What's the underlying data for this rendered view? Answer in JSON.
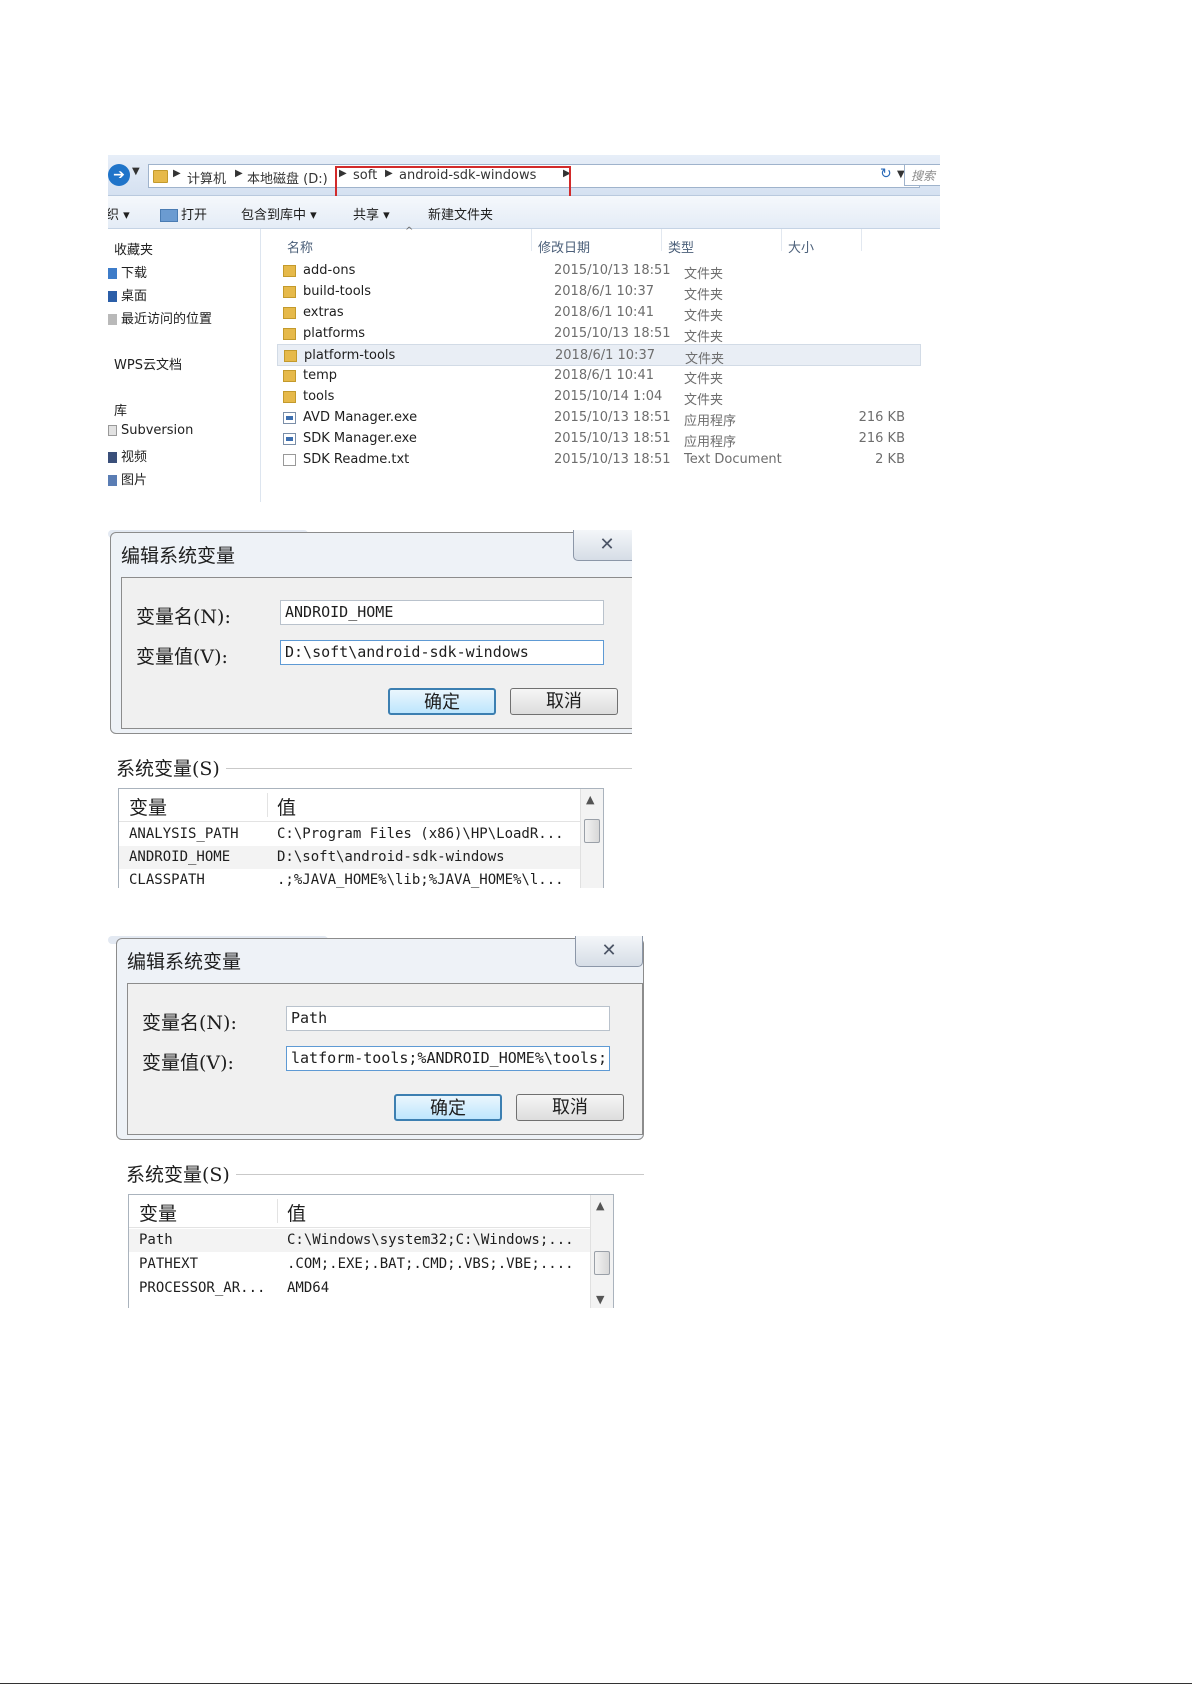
{
  "explorer": {
    "breadcrumbs": [
      "计算机",
      "本地磁盘 (D:)",
      "soft",
      "android-sdk-windows"
    ],
    "search_placeholder": "搜索",
    "toolbar": {
      "organize_label": "织",
      "open_label": "打开",
      "include_label": "包含到库中",
      "share_label": "共享",
      "new_folder_label": "新建文件夹"
    },
    "sidebar": {
      "favorites_label": "收藏夹",
      "items": [
        "下载",
        "桌面",
        "最近访问的位置"
      ],
      "wps_label": "WPS云文档",
      "library_label": "库",
      "library_items": [
        "Subversion",
        "视频",
        "图片"
      ]
    },
    "columns": {
      "name": "名称",
      "date": "修改日期",
      "type": "类型",
      "size": "大小"
    },
    "files": [
      {
        "name": "add-ons",
        "date": "2015/10/13 18:51",
        "type": "文件夹",
        "size": "",
        "icon": "folder-icon"
      },
      {
        "name": "build-tools",
        "date": "2018/6/1 10:37",
        "type": "文件夹",
        "size": "",
        "icon": "folder-icon"
      },
      {
        "name": "extras",
        "date": "2018/6/1 10:41",
        "type": "文件夹",
        "size": "",
        "icon": "folder-icon"
      },
      {
        "name": "platforms",
        "date": "2015/10/13 18:51",
        "type": "文件夹",
        "size": "",
        "icon": "folder-icon"
      },
      {
        "name": "platform-tools",
        "date": "2018/6/1 10:37",
        "type": "文件夹",
        "size": "",
        "icon": "folder-icon",
        "selected": true
      },
      {
        "name": "temp",
        "date": "2018/6/1 10:41",
        "type": "文件夹",
        "size": "",
        "icon": "folder-icon"
      },
      {
        "name": "tools",
        "date": "2015/10/14 1:04",
        "type": "文件夹",
        "size": "",
        "icon": "folder-icon"
      },
      {
        "name": "AVD Manager.exe",
        "date": "2015/10/13 18:51",
        "type": "应用程序",
        "size": "216 KB",
        "icon": "exe-icon"
      },
      {
        "name": "SDK Manager.exe",
        "date": "2015/10/13 18:51",
        "type": "应用程序",
        "size": "216 KB",
        "icon": "exe-icon"
      },
      {
        "name": "SDK Readme.txt",
        "date": "2015/10/13 18:51",
        "type": "Text Document",
        "size": "2 KB",
        "icon": "text-file-icon"
      }
    ]
  },
  "dialog1": {
    "title": "编辑系统变量",
    "close_glyph": "✕",
    "name_label": "变量名(N):",
    "name_value": "ANDROID_HOME",
    "value_label": "变量值(V):",
    "value_value": "D:\\soft\\android-sdk-windows",
    "ok_label": "确定",
    "cancel_label": "取消",
    "sysvars_label": "系统变量(S)",
    "table_headers": {
      "var": "变量",
      "val": "值"
    },
    "rows": [
      {
        "var": "ANALYSIS_PATH",
        "val": "C:\\Program Files (x86)\\HP\\LoadR..."
      },
      {
        "var": "ANDROID_HOME",
        "val": "D:\\soft\\android-sdk-windows"
      },
      {
        "var": "CLASSPATH",
        "val": ".;%JAVA_HOME%\\lib;%JAVA_HOME%\\l..."
      }
    ]
  },
  "dialog2": {
    "title": "编辑系统变量",
    "close_glyph": "✕",
    "name_label": "变量名(N):",
    "name_value": "Path",
    "value_label": "变量值(V):",
    "value_value": "latform-tools;%ANDROID_HOME%\\tools;",
    "ok_label": "确定",
    "cancel_label": "取消",
    "sysvars_label": "系统变量(S)",
    "table_headers": {
      "var": "变量",
      "val": "值"
    },
    "rows": [
      {
        "var": "Path",
        "val": "C:\\Windows\\system32;C:\\Windows;..."
      },
      {
        "var": "PATHEXT",
        "val": ".COM;.EXE;.BAT;.CMD;.VBS;.VBE;...."
      },
      {
        "var": "PROCESSOR_AR...",
        "val": "AMD64"
      }
    ]
  },
  "colors": {
    "highlight_box": "#d22a2a",
    "default_button": "#3c7fb1",
    "folder": "#e6b94a"
  }
}
